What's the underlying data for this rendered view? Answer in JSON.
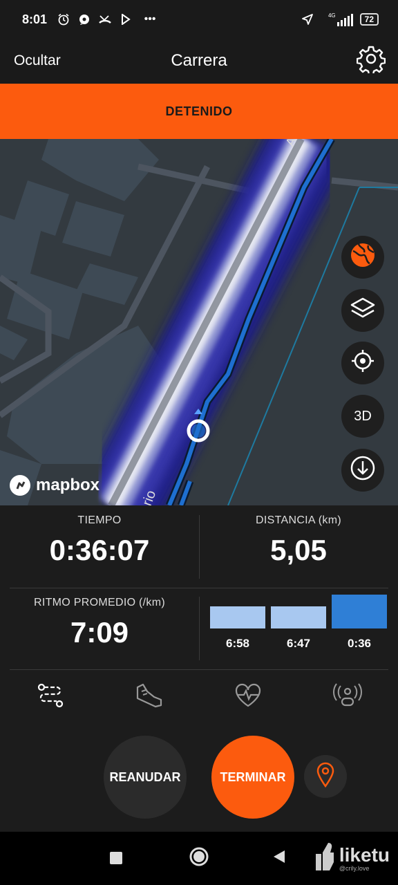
{
  "status_bar": {
    "time": "8:01",
    "network": "4G",
    "battery": "72",
    "overflow": "•••"
  },
  "header": {
    "hide_label": "Ocultar",
    "title": "Carrera"
  },
  "state_banner": "DETENIDO",
  "map": {
    "attribution": "mapbox",
    "street_fragment_top": "A",
    "street_fragment_bottom": "rio",
    "controls": {
      "three_d_label": "3D"
    },
    "colors": {
      "route": "#1e6fd0",
      "heatmap_core": "#e6e8f2",
      "heatmap_edge": "#1e1a8c",
      "land": "#333a40",
      "buildings": "#3e4a55",
      "roads": "#4d5560",
      "water_line": "#1e7aa0"
    }
  },
  "stats": {
    "time": {
      "label": "TIEMPO",
      "value": "0:36:07"
    },
    "distance": {
      "label": "DISTANCIA  (km)",
      "value": "5,05"
    },
    "avg_pace": {
      "label": "RITMO PROMEDIO  (/km)",
      "value": "7:09"
    },
    "splits": [
      {
        "label": "6:58",
        "level": 0.62,
        "color": "#a8c8f0"
      },
      {
        "label": "6:47",
        "level": 0.62,
        "color": "#a8c8f0"
      },
      {
        "label": "0:36",
        "level": 0.94,
        "color": "#2f7fd6"
      }
    ]
  },
  "tabs": [
    {
      "icon": "route-icon",
      "active": true
    },
    {
      "icon": "shoe-icon",
      "active": false
    },
    {
      "icon": "heart-rate-icon",
      "active": false
    },
    {
      "icon": "sensor-icon",
      "active": false
    }
  ],
  "actions": {
    "resume_label": "REANUDAR",
    "finish_label": "TERMINAR",
    "colors": {
      "finish": "#fc5b0e",
      "pin": "#fc5b0e"
    }
  },
  "watermark": {
    "brand": "liketu",
    "handle": "@crily.love"
  }
}
